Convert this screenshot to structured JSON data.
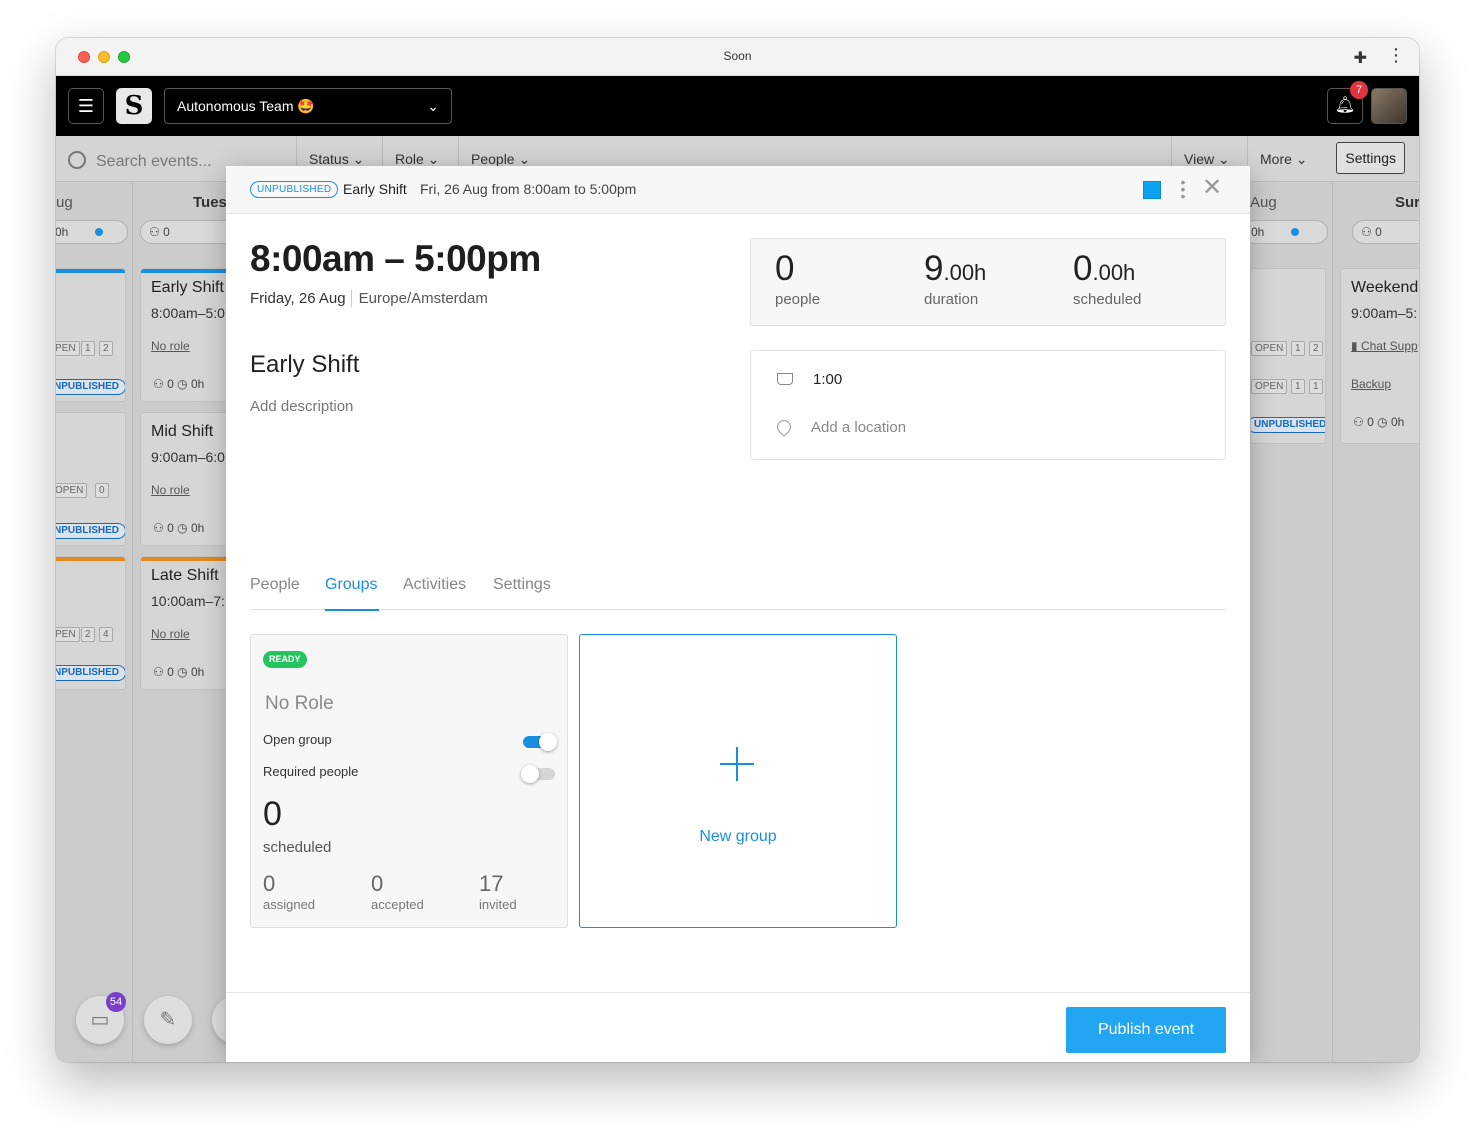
{
  "window": {
    "title": "Soon"
  },
  "appbar": {
    "team_name": "Autonomous Team 🤩",
    "notifications": "7"
  },
  "filterbar": {
    "search_placeholder": "Search events...",
    "status": "Status",
    "role": "Role",
    "people": "People",
    "view": "View",
    "more": "More",
    "settings": "Settings"
  },
  "board": {
    "col0_head": "ug",
    "col0_pill": "0h",
    "col1_head": "Tues",
    "col1_pill_people": "0",
    "col5_head": "Aug",
    "col5_pill": "0h",
    "col6_head": "Sur",
    "col6_pill_people": "0",
    "cards": {
      "early_title": "Early Shift",
      "early_time": "8:00am–5:0",
      "mid_title": "Mid Shift",
      "mid_time": "9:00am–6:0",
      "late_title": "Late Shift",
      "late_time": "10:00am–7:",
      "no_role": "No role",
      "weekend_title": "Weekend",
      "weekend_time": "9:00am–5:",
      "chat_support": "Chat Supp",
      "backup": "Backup",
      "stat_people": "0",
      "stat_hours": "0h",
      "stat_hours_cut": "0h"
    },
    "tags": {
      "open_cut": "PEN",
      "open": "OPEN",
      "open_cut2": "OPEN",
      "unpublished_cut": "NPUBLISHED",
      "unpublished": "UNPUBLISHED",
      "n1": "1",
      "n2": "2",
      "n0": "0",
      "n4": "4"
    },
    "inbox_count": "54"
  },
  "modal": {
    "status_badge": "UNPUBLISHED",
    "event_name": "Early Shift",
    "header_date": "Fri, 26 Aug from 8:00am to 5:00pm",
    "color": "#0ba3f0",
    "time_range": "8:00am – 5:00pm",
    "date": "Friday, 26 Aug",
    "timezone": "Europe/Amsterdam",
    "title": "Early Shift",
    "description_placeholder": "Add description",
    "stats": {
      "people_value": "0",
      "people_label": "people",
      "duration_int": "9",
      "duration_frac": ".00h",
      "duration_label": "duration",
      "scheduled_int": "0",
      "scheduled_frac": ".00h",
      "scheduled_label": "scheduled"
    },
    "break_value": "1:00",
    "location_placeholder": "Add a location",
    "tabs": [
      "People",
      "Groups",
      "Activities",
      "Settings"
    ],
    "active_tab": "Groups",
    "group": {
      "status": "READY",
      "role": "No Role",
      "open_group_label": "Open group",
      "open_group_on": true,
      "required_people_label": "Required people",
      "required_people_on": false,
      "scheduled_value": "0",
      "scheduled_label": "scheduled",
      "assigned_value": "0",
      "assigned_label": "assigned",
      "accepted_value": "0",
      "accepted_label": "accepted",
      "invited_value": "17",
      "invited_label": "invited"
    },
    "new_group_label": "New group",
    "publish_button": "Publish event"
  }
}
